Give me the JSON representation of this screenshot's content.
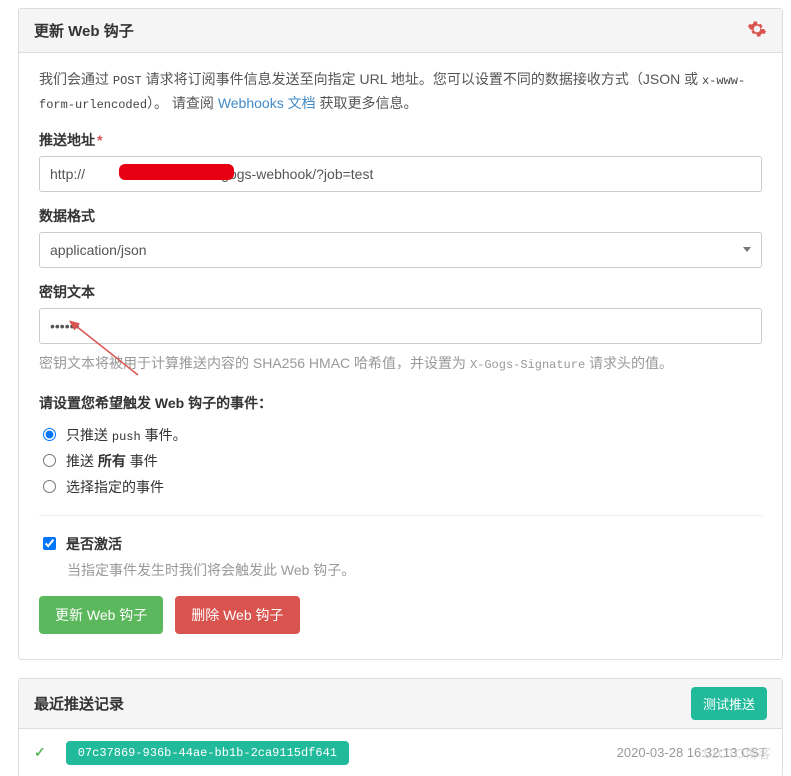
{
  "header": {
    "title": "更新 Web 钩子"
  },
  "desc": {
    "prefix": "我们会通过 ",
    "code1": "POST",
    "mid1": " 请求将订阅事件信息发送至向指定 URL 地址。您可以设置不同的数据接收方式（JSON 或 ",
    "code2": "x-www-form-urlencoded",
    "mid2": "）。 请查阅 ",
    "link": "Webhooks 文档",
    "suffix": " 获取更多信息。"
  },
  "fields": {
    "url_label": "推送地址",
    "url_value": "http://                         :8080/gogs-webhook/?job=test",
    "format_label": "数据格式",
    "format_value": "application/json",
    "secret_label": "密钥文本",
    "secret_value": "••••••",
    "secret_help_pre": "密钥文本将被用于计算推送内容的 SHA256 HMAC 哈希值，并设置为 ",
    "secret_help_code": "X-Gogs-Signature",
    "secret_help_post": " 请求头的值。"
  },
  "events": {
    "title": "请设置您希望触发 Web 钩子的事件：",
    "opt1_pre": "只推送 ",
    "opt1_code": "push",
    "opt1_post": " 事件。",
    "opt2_pre": "推送 ",
    "opt2_bold": "所有",
    "opt2_post": " 事件",
    "opt3": "选择指定的事件"
  },
  "active": {
    "label": "是否激活",
    "help": "当指定事件发生时我们将会触发此 Web 钩子。"
  },
  "buttons": {
    "update": "更新 Web 钩子",
    "delete": "删除 Web 钩子",
    "test": "测试推送"
  },
  "records": {
    "title": "最近推送记录",
    "items": [
      {
        "uuid": "07c37869-936b-44ae-bb1b-2ca9115df641",
        "time": "2020-03-28 16:32:13 CST"
      }
    ]
  },
  "watermark": "51CTO博客"
}
